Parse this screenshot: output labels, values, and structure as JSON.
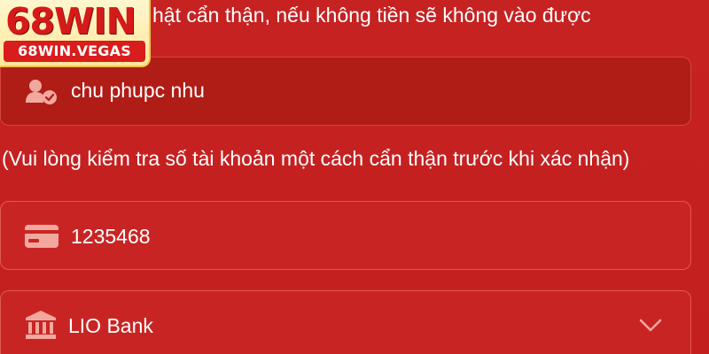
{
  "brand": {
    "logo_text": "68WIN",
    "logo_domain": "68WIN.VEGAS"
  },
  "top_note": "hật cẩn thận, nếu không tiền sẽ không vào được",
  "account_name": {
    "icon": "user-check-icon",
    "value": "chu phupc nhu"
  },
  "account_hint": "(Vui lòng kiểm tra số tài khoản một cách cẩn thận trước khi xác nhận)",
  "account_number": {
    "icon": "card-icon",
    "value": "1235468"
  },
  "bank": {
    "icon": "bank-icon",
    "selected": "LIO Bank",
    "dropdown_icon": "chevron-down-icon"
  },
  "colors": {
    "background": "#c62222",
    "field_dark": "#b01c16",
    "icon": "#f3a89f",
    "logo_bg": "#fff6cf",
    "logo_red": "#d61a1a"
  }
}
